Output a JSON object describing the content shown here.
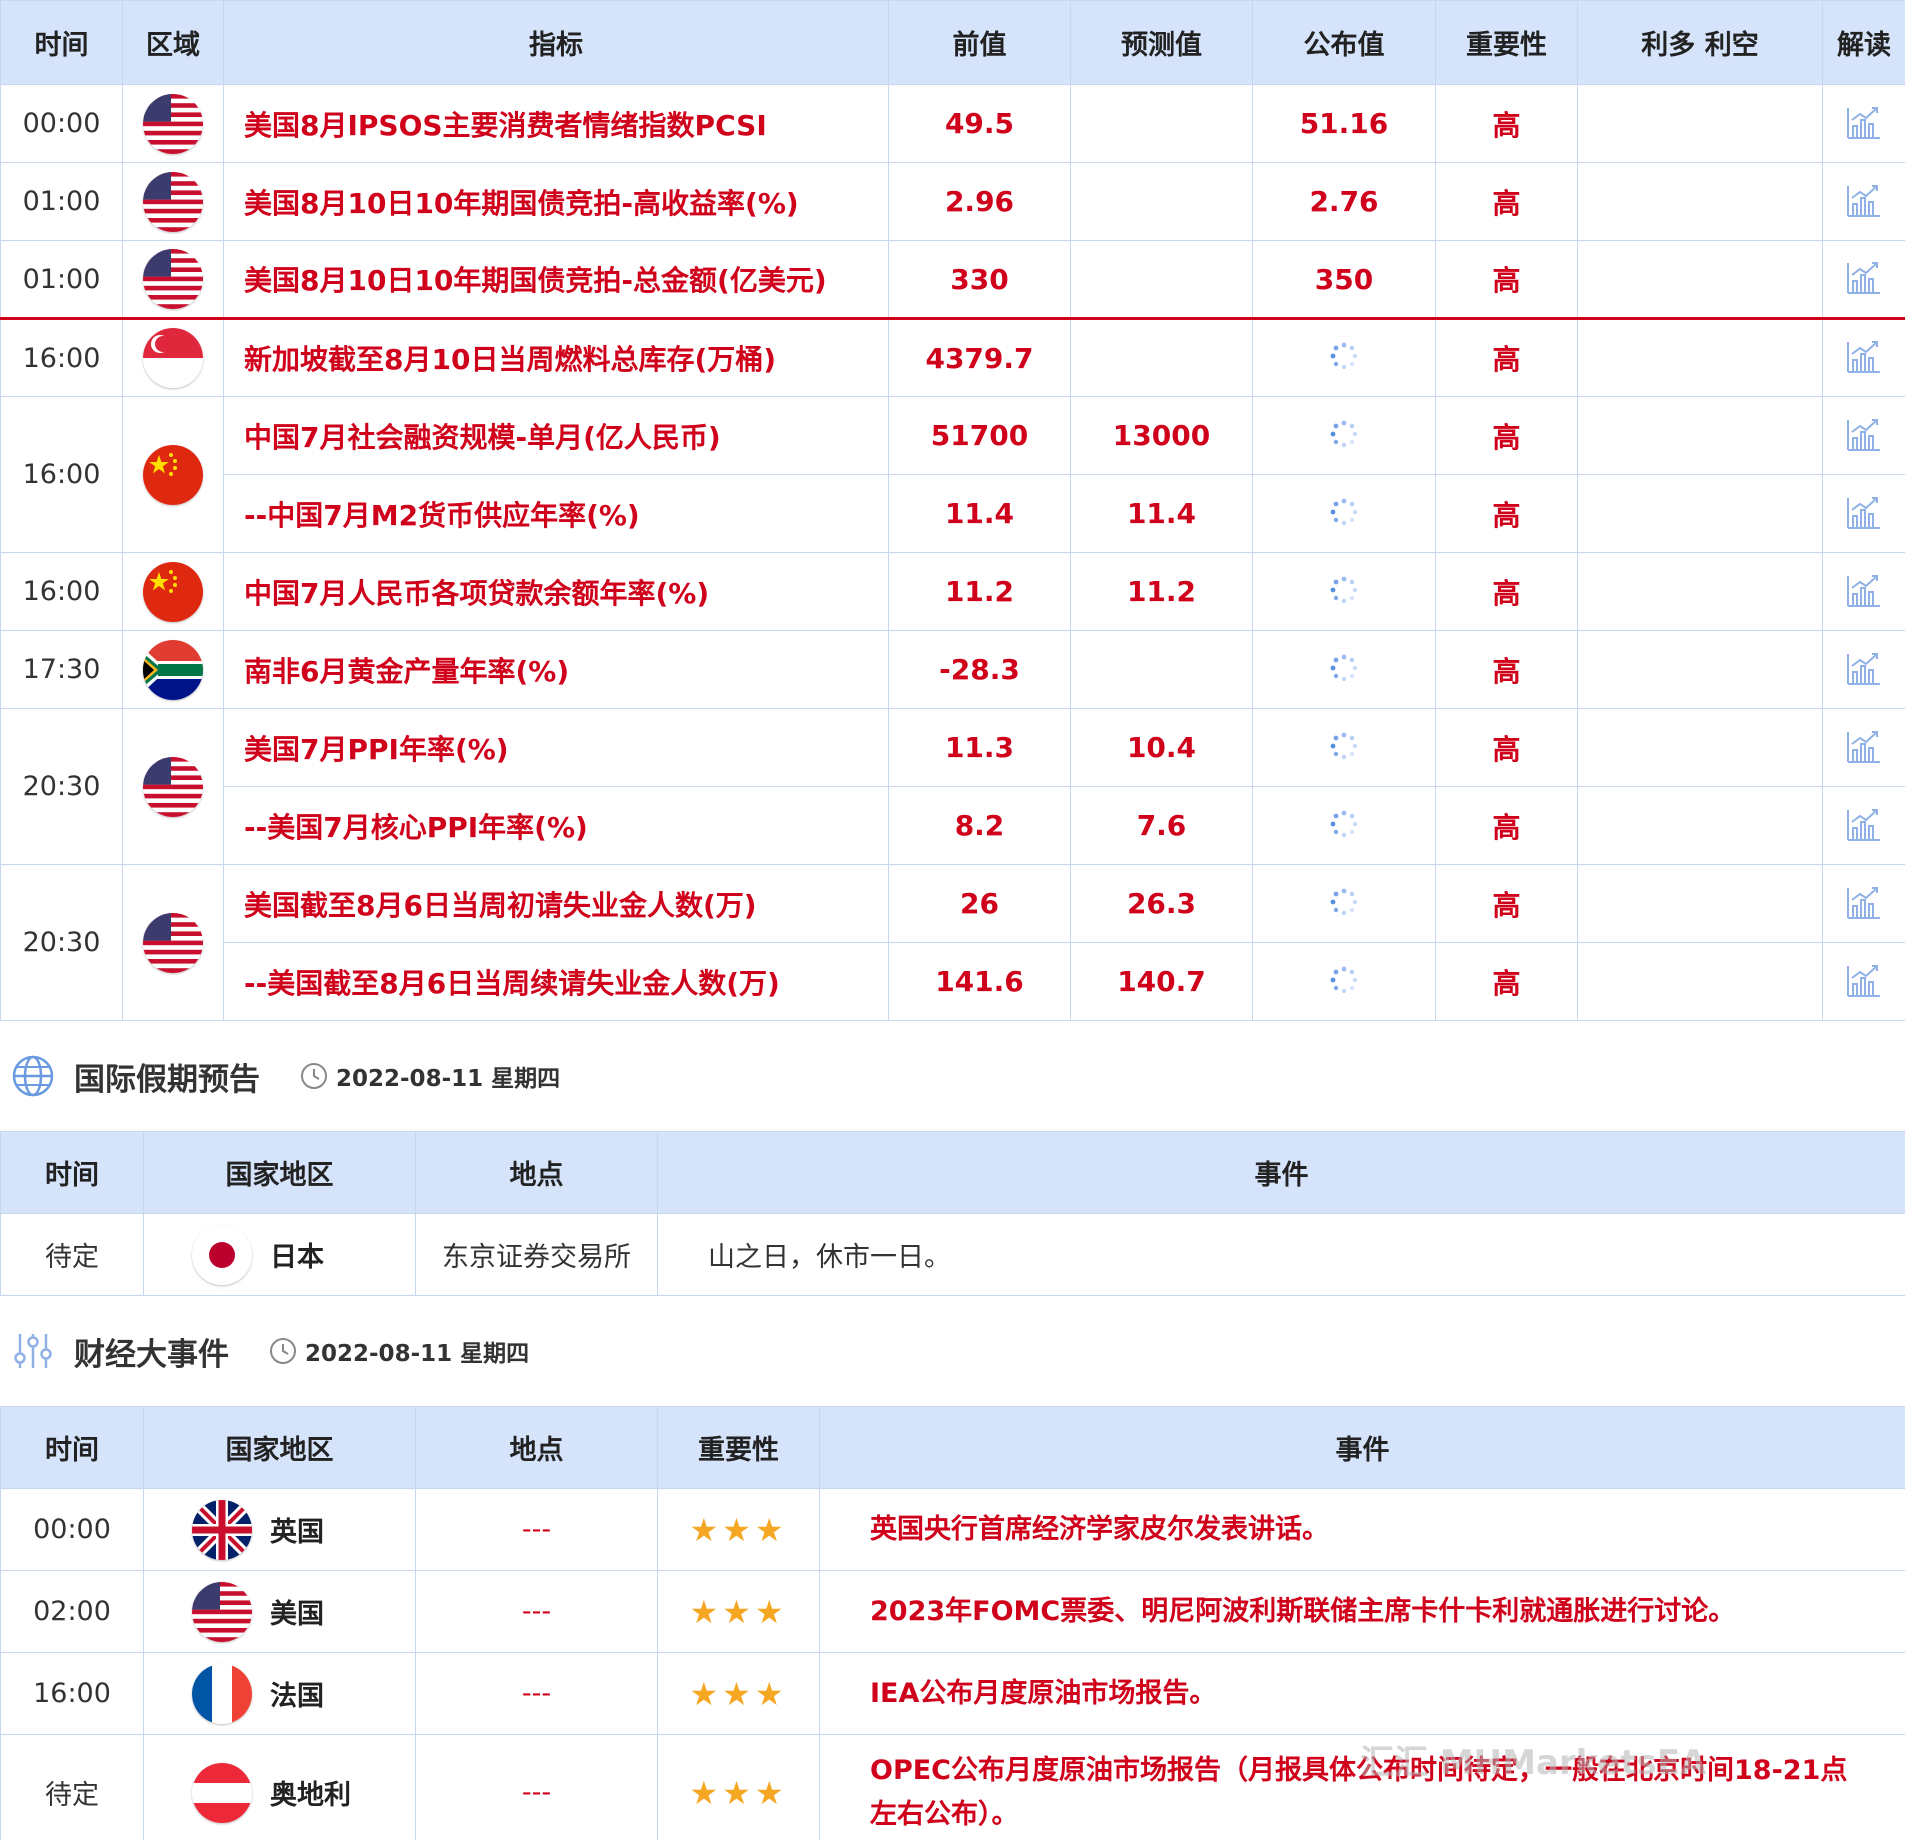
{
  "calendar": {
    "headers": [
      "时间",
      "区域",
      "指标",
      "前值",
      "预测值",
      "公布值",
      "重要性",
      "利多 利空",
      "解读"
    ],
    "rows": [
      {
        "time": "00:00",
        "indicator": "美国8月IPSOS主要消费者情绪指数PCSI",
        "prev": "49.5",
        "forecast": "",
        "actual": "51.16",
        "importance": "高"
      },
      {
        "time": "01:00",
        "indicator": "美国8月10日10年期国债竞拍-高收益率(%)",
        "prev": "2.96",
        "forecast": "",
        "actual": "2.76",
        "importance": "高"
      },
      {
        "time": "01:00",
        "indicator": "美国8月10日10年期国债竞拍-总金额(亿美元)",
        "prev": "330",
        "forecast": "",
        "actual": "350",
        "importance": "高"
      },
      {
        "time": "16:00",
        "indicator": "新加坡截至8月10日当周燃料总库存(万桶)",
        "prev": "4379.7",
        "forecast": "",
        "actual": "",
        "importance": "高"
      },
      {
        "time": "16:00",
        "indicator": "中国7月社会融资规模-单月(亿人民币)",
        "prev": "51700",
        "forecast": "13000",
        "actual": "",
        "importance": "高"
      },
      {
        "time": "",
        "indicator": "--中国7月M2货币供应年率(%)",
        "prev": "11.4",
        "forecast": "11.4",
        "actual": "",
        "importance": "高"
      },
      {
        "time": "16:00",
        "indicator": "中国7月人民币各项贷款余额年率(%)",
        "prev": "11.2",
        "forecast": "11.2",
        "actual": "",
        "importance": "高"
      },
      {
        "time": "17:30",
        "indicator": "南非6月黄金产量年率(%)",
        "prev": "-28.3",
        "forecast": "",
        "actual": "",
        "importance": "高"
      },
      {
        "time": "20:30",
        "indicator": "美国7月PPI年率(%)",
        "prev": "11.3",
        "forecast": "10.4",
        "actual": "",
        "importance": "高"
      },
      {
        "time": "",
        "indicator": "--美国7月核心PPI年率(%)",
        "prev": "8.2",
        "forecast": "7.6",
        "actual": "",
        "importance": "高"
      },
      {
        "time": "20:30",
        "indicator": "美国截至8月6日当周初请失业金人数(万)",
        "prev": "26",
        "forecast": "26.3",
        "actual": "",
        "importance": "高"
      },
      {
        "time": "",
        "indicator": "--美国截至8月6日当周续请失业金人数(万)",
        "prev": "141.6",
        "forecast": "140.7",
        "actual": "",
        "importance": "高"
      }
    ]
  },
  "holiday": {
    "title": "国际假期预告",
    "date": "2022-08-11 星期四",
    "headers": [
      "时间",
      "国家地区",
      "地点",
      "事件"
    ],
    "rows": [
      {
        "time": "待定",
        "country": "日本",
        "place": "东京证券交易所",
        "event": "山之日，休市一日。"
      }
    ]
  },
  "events": {
    "title": "财经大事件",
    "date": "2022-08-11 星期四",
    "headers": [
      "时间",
      "国家地区",
      "地点",
      "重要性",
      "事件"
    ],
    "rows": [
      {
        "time": "00:00",
        "country": "英国",
        "place": "---",
        "stars": "★★★",
        "event": "英国央行首席经济学家皮尔发表讲话。"
      },
      {
        "time": "02:00",
        "country": "美国",
        "place": "---",
        "stars": "★★★",
        "event": "2023年FOMC票委、明尼阿波利斯联储主席卡什卡利就通胀进行讨论。"
      },
      {
        "time": "16:00",
        "country": "法国",
        "place": "---",
        "stars": "★★★",
        "event": "IEA公布月度原油市场报告。"
      },
      {
        "time": "待定",
        "country": "奥地利",
        "place": "---",
        "stars": "★★★",
        "event": "OPEC公布月度原油市场报告（月报具体公布时间待定，一般在北京时间18-21点左右公布）。"
      }
    ]
  },
  "watermark": "汇汇 MHMarketsEA",
  "colors": {
    "header_bg": "#d6e4fb",
    "accent_red": "#d0021b",
    "star": "#f5a623",
    "border": "#c9d7ee"
  }
}
